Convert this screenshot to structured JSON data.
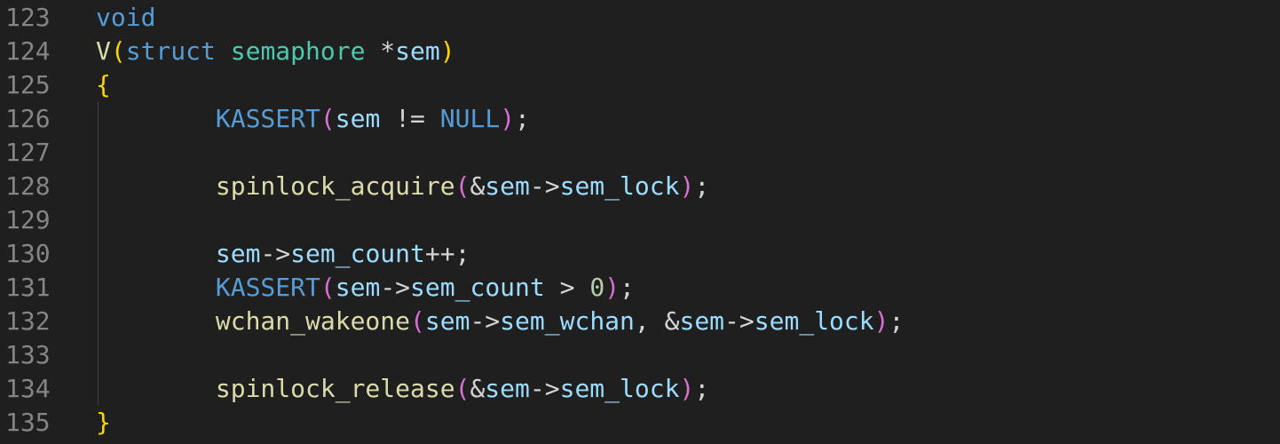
{
  "editor": {
    "lines": [
      {
        "number": "123",
        "tokens": [
          [
            "void",
            "kw"
          ]
        ]
      },
      {
        "number": "124",
        "tokens": [
          [
            "V",
            "fn"
          ],
          [
            "(",
            "p1"
          ],
          [
            "struct",
            "kw"
          ],
          [
            " ",
            "op"
          ],
          [
            "semaphore",
            "ty"
          ],
          [
            " *",
            "op"
          ],
          [
            "sem",
            "var"
          ],
          [
            ")",
            "p1"
          ]
        ]
      },
      {
        "number": "125",
        "tokens": [
          [
            "{",
            "p1"
          ]
        ]
      },
      {
        "number": "126",
        "indent": true,
        "tokens": [
          [
            "\t",
            "op"
          ],
          [
            "KASSERT",
            "kw"
          ],
          [
            "(",
            "p2"
          ],
          [
            "sem",
            "var"
          ],
          [
            " != ",
            "op"
          ],
          [
            "NULL",
            "kw"
          ],
          [
            ")",
            "p2"
          ],
          [
            ";",
            "op"
          ]
        ]
      },
      {
        "number": "127",
        "indent": true,
        "tokens": []
      },
      {
        "number": "128",
        "indent": true,
        "tokens": [
          [
            "\t",
            "op"
          ],
          [
            "spinlock_acquire",
            "fn"
          ],
          [
            "(",
            "p2"
          ],
          [
            "&",
            "op"
          ],
          [
            "sem",
            "var"
          ],
          [
            "->",
            "op"
          ],
          [
            "sem_lock",
            "var"
          ],
          [
            ")",
            "p2"
          ],
          [
            ";",
            "op"
          ]
        ]
      },
      {
        "number": "129",
        "indent": true,
        "tokens": []
      },
      {
        "number": "130",
        "indent": true,
        "tokens": [
          [
            "\t",
            "op"
          ],
          [
            "sem",
            "var"
          ],
          [
            "->",
            "op"
          ],
          [
            "sem_count",
            "var"
          ],
          [
            "++;",
            "op"
          ]
        ]
      },
      {
        "number": "131",
        "indent": true,
        "tokens": [
          [
            "\t",
            "op"
          ],
          [
            "KASSERT",
            "kw"
          ],
          [
            "(",
            "p2"
          ],
          [
            "sem",
            "var"
          ],
          [
            "->",
            "op"
          ],
          [
            "sem_count",
            "var"
          ],
          [
            " > ",
            "op"
          ],
          [
            "0",
            "num"
          ],
          [
            ")",
            "p2"
          ],
          [
            ";",
            "op"
          ]
        ]
      },
      {
        "number": "132",
        "indent": true,
        "tokens": [
          [
            "\t",
            "op"
          ],
          [
            "wchan_wakeone",
            "fn"
          ],
          [
            "(",
            "p2"
          ],
          [
            "sem",
            "var"
          ],
          [
            "->",
            "op"
          ],
          [
            "sem_wchan",
            "var"
          ],
          [
            ", &",
            "op"
          ],
          [
            "sem",
            "var"
          ],
          [
            "->",
            "op"
          ],
          [
            "sem_lock",
            "var"
          ],
          [
            ")",
            "p2"
          ],
          [
            ";",
            "op"
          ]
        ]
      },
      {
        "number": "133",
        "indent": true,
        "tokens": []
      },
      {
        "number": "134",
        "indent": true,
        "tokens": [
          [
            "\t",
            "op"
          ],
          [
            "spinlock_release",
            "fn"
          ],
          [
            "(",
            "p2"
          ],
          [
            "&",
            "op"
          ],
          [
            "sem",
            "var"
          ],
          [
            "->",
            "op"
          ],
          [
            "sem_lock",
            "var"
          ],
          [
            ")",
            "p2"
          ],
          [
            ";",
            "op"
          ]
        ]
      },
      {
        "number": "135",
        "tokens": [
          [
            "}",
            "p1"
          ]
        ]
      }
    ]
  }
}
